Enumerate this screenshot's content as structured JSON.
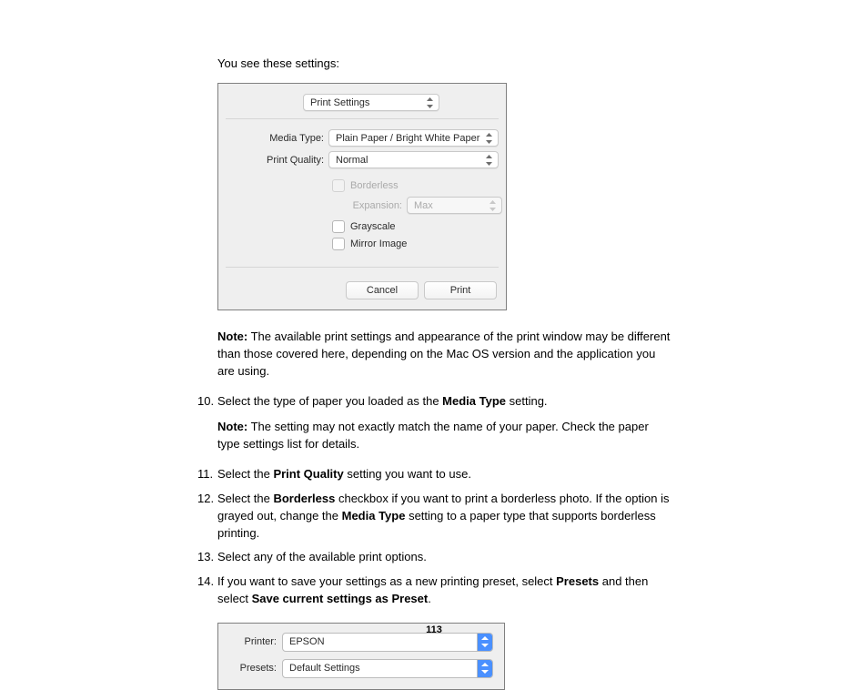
{
  "intro": "You see these settings:",
  "panel1": {
    "settings_select": "Print Settings",
    "media_type_label": "Media Type:",
    "media_type_value": "Plain Paper / Bright White Paper",
    "print_quality_label": "Print Quality:",
    "print_quality_value": "Normal",
    "borderless_label": "Borderless",
    "expansion_label": "Expansion:",
    "expansion_value": "Max",
    "grayscale_label": "Grayscale",
    "mirror_label": "Mirror Image",
    "cancel": "Cancel",
    "print": "Print"
  },
  "note1_prefix": "Note:",
  "note1_text": " The available print settings and appearance of the print window may be different than those covered here, depending on the Mac OS version and the application you are using.",
  "steps": {
    "s10_num": "10.",
    "s10_a": "Select the type of paper you loaded as the ",
    "s10_b": "Media Type",
    "s10_c": " setting.",
    "s10_note_prefix": "Note:",
    "s10_note_text": " The setting may not exactly match the name of your paper. Check the paper type settings list for details.",
    "s11_num": "11.",
    "s11_a": "Select the ",
    "s11_b": "Print Quality",
    "s11_c": " setting you want to use.",
    "s12_num": "12.",
    "s12_a": "Select the ",
    "s12_b": "Borderless",
    "s12_c": " checkbox if you want to print a borderless photo. If the option is grayed out, change the ",
    "s12_d": "Media Type",
    "s12_e": " setting to a paper type that supports borderless printing.",
    "s13_num": "13.",
    "s13_a": "Select any of the available print options.",
    "s14_num": "14.",
    "s14_a": "If you want to save your settings as a new printing preset, select ",
    "s14_b": "Presets",
    "s14_c": " and then select ",
    "s14_d": "Save current settings as Preset",
    "s14_e": "."
  },
  "panel2": {
    "printer_label": "Printer:",
    "printer_value": "EPSON",
    "presets_label": "Presets:",
    "presets_value": "Default Settings"
  },
  "page_number": "113"
}
